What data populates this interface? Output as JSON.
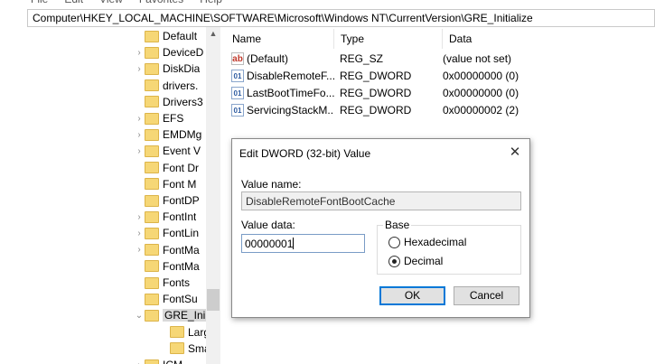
{
  "menu": [
    "File",
    "Edit",
    "View",
    "Favorites",
    "Help"
  ],
  "address": "Computer\\HKEY_LOCAL_MACHINE\\SOFTWARE\\Microsoft\\Windows NT\\CurrentVersion\\GRE_Initialize",
  "tree": {
    "items": [
      {
        "label": "Default",
        "expander": ""
      },
      {
        "label": "DeviceD",
        "expander": "›"
      },
      {
        "label": "DiskDia",
        "expander": "›"
      },
      {
        "label": "drivers.",
        "expander": ""
      },
      {
        "label": "Drivers3",
        "expander": ""
      },
      {
        "label": "EFS",
        "expander": "›"
      },
      {
        "label": "EMDMg",
        "expander": "›"
      },
      {
        "label": "Event V",
        "expander": "›"
      },
      {
        "label": "Font Dr",
        "expander": ""
      },
      {
        "label": "Font M",
        "expander": ""
      },
      {
        "label": "FontDP",
        "expander": ""
      },
      {
        "label": "FontInt",
        "expander": "›"
      },
      {
        "label": "FontLin",
        "expander": "›"
      },
      {
        "label": "FontMa",
        "expander": "›"
      },
      {
        "label": "FontMa",
        "expander": ""
      },
      {
        "label": "Fonts",
        "expander": ""
      },
      {
        "label": "FontSu",
        "expander": ""
      },
      {
        "label": "GRE_Ini",
        "expander": "⌄",
        "selected": true
      },
      {
        "label": "Larg",
        "expander": "",
        "child": true
      },
      {
        "label": "Sma",
        "expander": "",
        "child": true
      },
      {
        "label": "ICM",
        "expander": "›"
      }
    ]
  },
  "list": {
    "headers": {
      "name": "Name",
      "type": "Type",
      "data": "Data"
    },
    "rows": [
      {
        "icon": "ab",
        "name": "(Default)",
        "type": "REG_SZ",
        "data": "(value not set)"
      },
      {
        "icon": "01",
        "name": "DisableRemoteF...",
        "type": "REG_DWORD",
        "data": "0x00000000 (0)"
      },
      {
        "icon": "01",
        "name": "LastBootTimeFo...",
        "type": "REG_DWORD",
        "data": "0x00000000 (0)"
      },
      {
        "icon": "01",
        "name": "ServicingStackM...",
        "type": "REG_DWORD",
        "data": "0x00000002 (2)"
      }
    ]
  },
  "dialog": {
    "title": "Edit DWORD (32-bit) Value",
    "close": "✕",
    "value_name_label": "Value name:",
    "value_name": "DisableRemoteFontBootCache",
    "value_data_label": "Value data:",
    "value_data": "00000001",
    "base_label": "Base",
    "hex_label": "Hexadecimal",
    "dec_label": "Decimal",
    "ok_label": "OK",
    "cancel_label": "Cancel"
  }
}
